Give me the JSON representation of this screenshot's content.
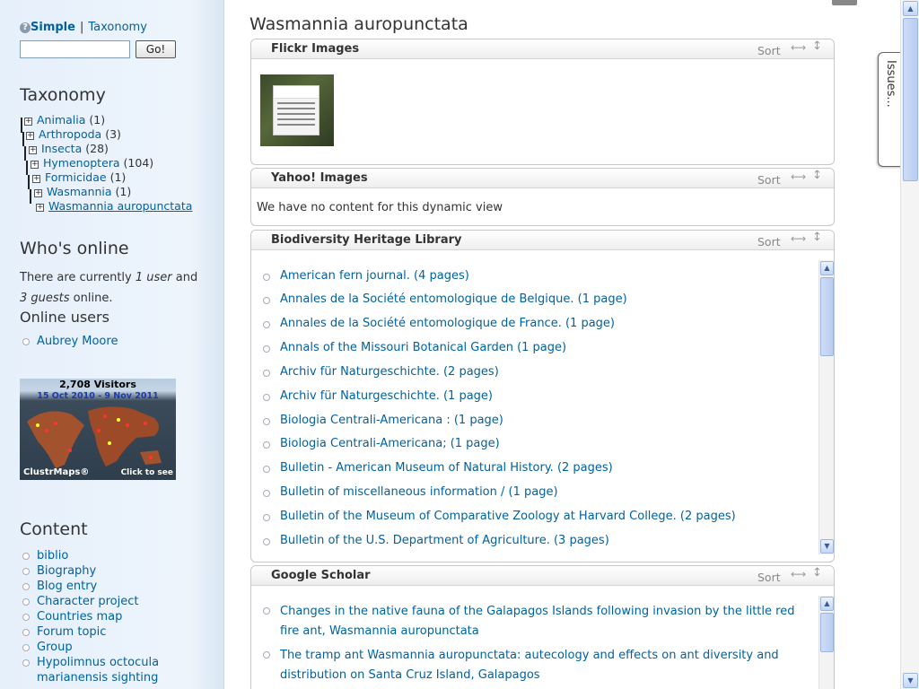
{
  "switcher": {
    "help": "?",
    "simple": "Simple",
    "separator": "|",
    "taxonomy": "Taxonomy"
  },
  "search": {
    "value": "",
    "go_label": "Go!"
  },
  "taxonomy_block": {
    "title": "Taxonomy",
    "items": [
      {
        "label": "Animalia",
        "count": "(1)"
      },
      {
        "label": "Arthropoda",
        "count": "(3)"
      },
      {
        "label": "Insecta",
        "count": "(28)"
      },
      {
        "label": "Hymenoptera",
        "count": "(104)"
      },
      {
        "label": "Formicidae",
        "count": "(1)"
      },
      {
        "label": "Wasmannia",
        "count": "(1)"
      },
      {
        "label": "Wasmannia auropunctata",
        "count": ""
      }
    ]
  },
  "whos_online": {
    "title": "Who's online",
    "text_pre": "There are currently ",
    "users": "1 user",
    "text_mid": " and ",
    "guests": "3 guests",
    "text_post": " online.",
    "online_users_title": "Online users",
    "online_users": [
      "Aubrey Moore"
    ]
  },
  "clustrmap": {
    "visitors": "2,708 Visitors",
    "dates": "15 Oct 2010 - 9 Nov 2011",
    "brand": "ClustrMaps®",
    "click": "Click to see"
  },
  "content_block": {
    "title": "Content",
    "items": [
      "biblio",
      "Biography",
      "Blog entry",
      "Character project",
      "Countries map",
      "Forum topic",
      "Group",
      "Hypolimnus octocula marianensis sighting"
    ]
  },
  "main": {
    "page_title": "Wasmannia auropunctata",
    "panels": {
      "flickr": {
        "title": "Flickr Images",
        "sort": "Sort"
      },
      "yahoo": {
        "title": "Yahoo! Images",
        "sort": "Sort",
        "empty": "We have no content for this dynamic view"
      },
      "bhl": {
        "title": "Biodiversity Heritage Library",
        "sort": "Sort",
        "items": [
          "American fern journal. (4 pages)",
          "Annales de la Société entomologique de Belgique. (1 page)",
          "Annales de la Société entomologique de France. (1 page)",
          "Annals of the Missouri Botanical Garden (1 page)",
          "Archiv für Naturgeschichte. (2 pages)",
          "Archiv für Naturgeschichte. (1 page)",
          "Biologia Centrali-Americana : (1 page)",
          "Biologia Centrali-Americana; (1 page)",
          "Bulletin - American Museum of Natural History. (2 pages)",
          "Bulletin of miscellaneous information / (1 page)",
          "Bulletin of the Museum of Comparative Zoology at Harvard College. (2 pages)",
          "Bulletin of the U.S. Department of Agriculture. (3 pages)"
        ]
      },
      "scholar": {
        "title": "Google Scholar",
        "sort": "Sort",
        "items": [
          "Changes in the native fauna of the Galapagos Islands following invasion by the little red fire ant, Wasmannia auropunctata",
          "The tramp ant Wasmannia auropunctata: autecology and effects on ant diversity and distribution on Santa Cruz Island, Galapagos"
        ]
      }
    }
  },
  "issues_tab": "Issues...",
  "icons": {
    "plus": "plus-box-icon",
    "resize_h": "resize-horizontal-icon",
    "resize_v": "resize-vertical-icon",
    "scroll_up": "scroll-up-icon",
    "scroll_down": "scroll-down-icon"
  }
}
